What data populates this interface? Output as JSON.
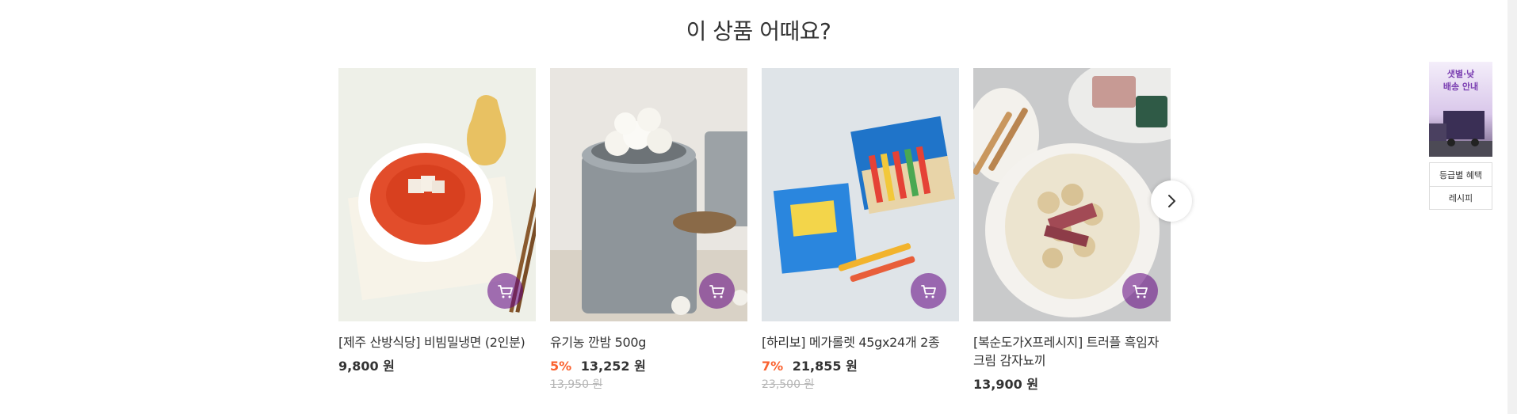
{
  "section": {
    "title": "이 상품 어때요?"
  },
  "products": [
    {
      "name": "[제주 산방식당] 비빔밀냉면 (2인분)",
      "discount": "",
      "price": "9,800 원",
      "original_price": ""
    },
    {
      "name": "유기농 깐밤 500g",
      "discount": "5%",
      "price": "13,252 원",
      "original_price": "13,950 원"
    },
    {
      "name": "[하리보] 메가롤렛 45gx24개 2종",
      "discount": "7%",
      "price": "21,855 원",
      "original_price": "23,500 원"
    },
    {
      "name": "[복순도가X프레시지] 트러플 흑임자 크림 감자뇨끼",
      "discount": "",
      "price": "13,900 원",
      "original_price": ""
    }
  ],
  "side": {
    "banner_text": "샛별·낮\n배송 안내",
    "menu": [
      "등급별 혜택",
      "레시피"
    ]
  },
  "colors": {
    "accent": "#5f0080",
    "discount": "#fa622f",
    "strike": "#b5b5b5"
  },
  "icons": {
    "cart": "cart-icon",
    "next": "chevron-right-icon"
  }
}
